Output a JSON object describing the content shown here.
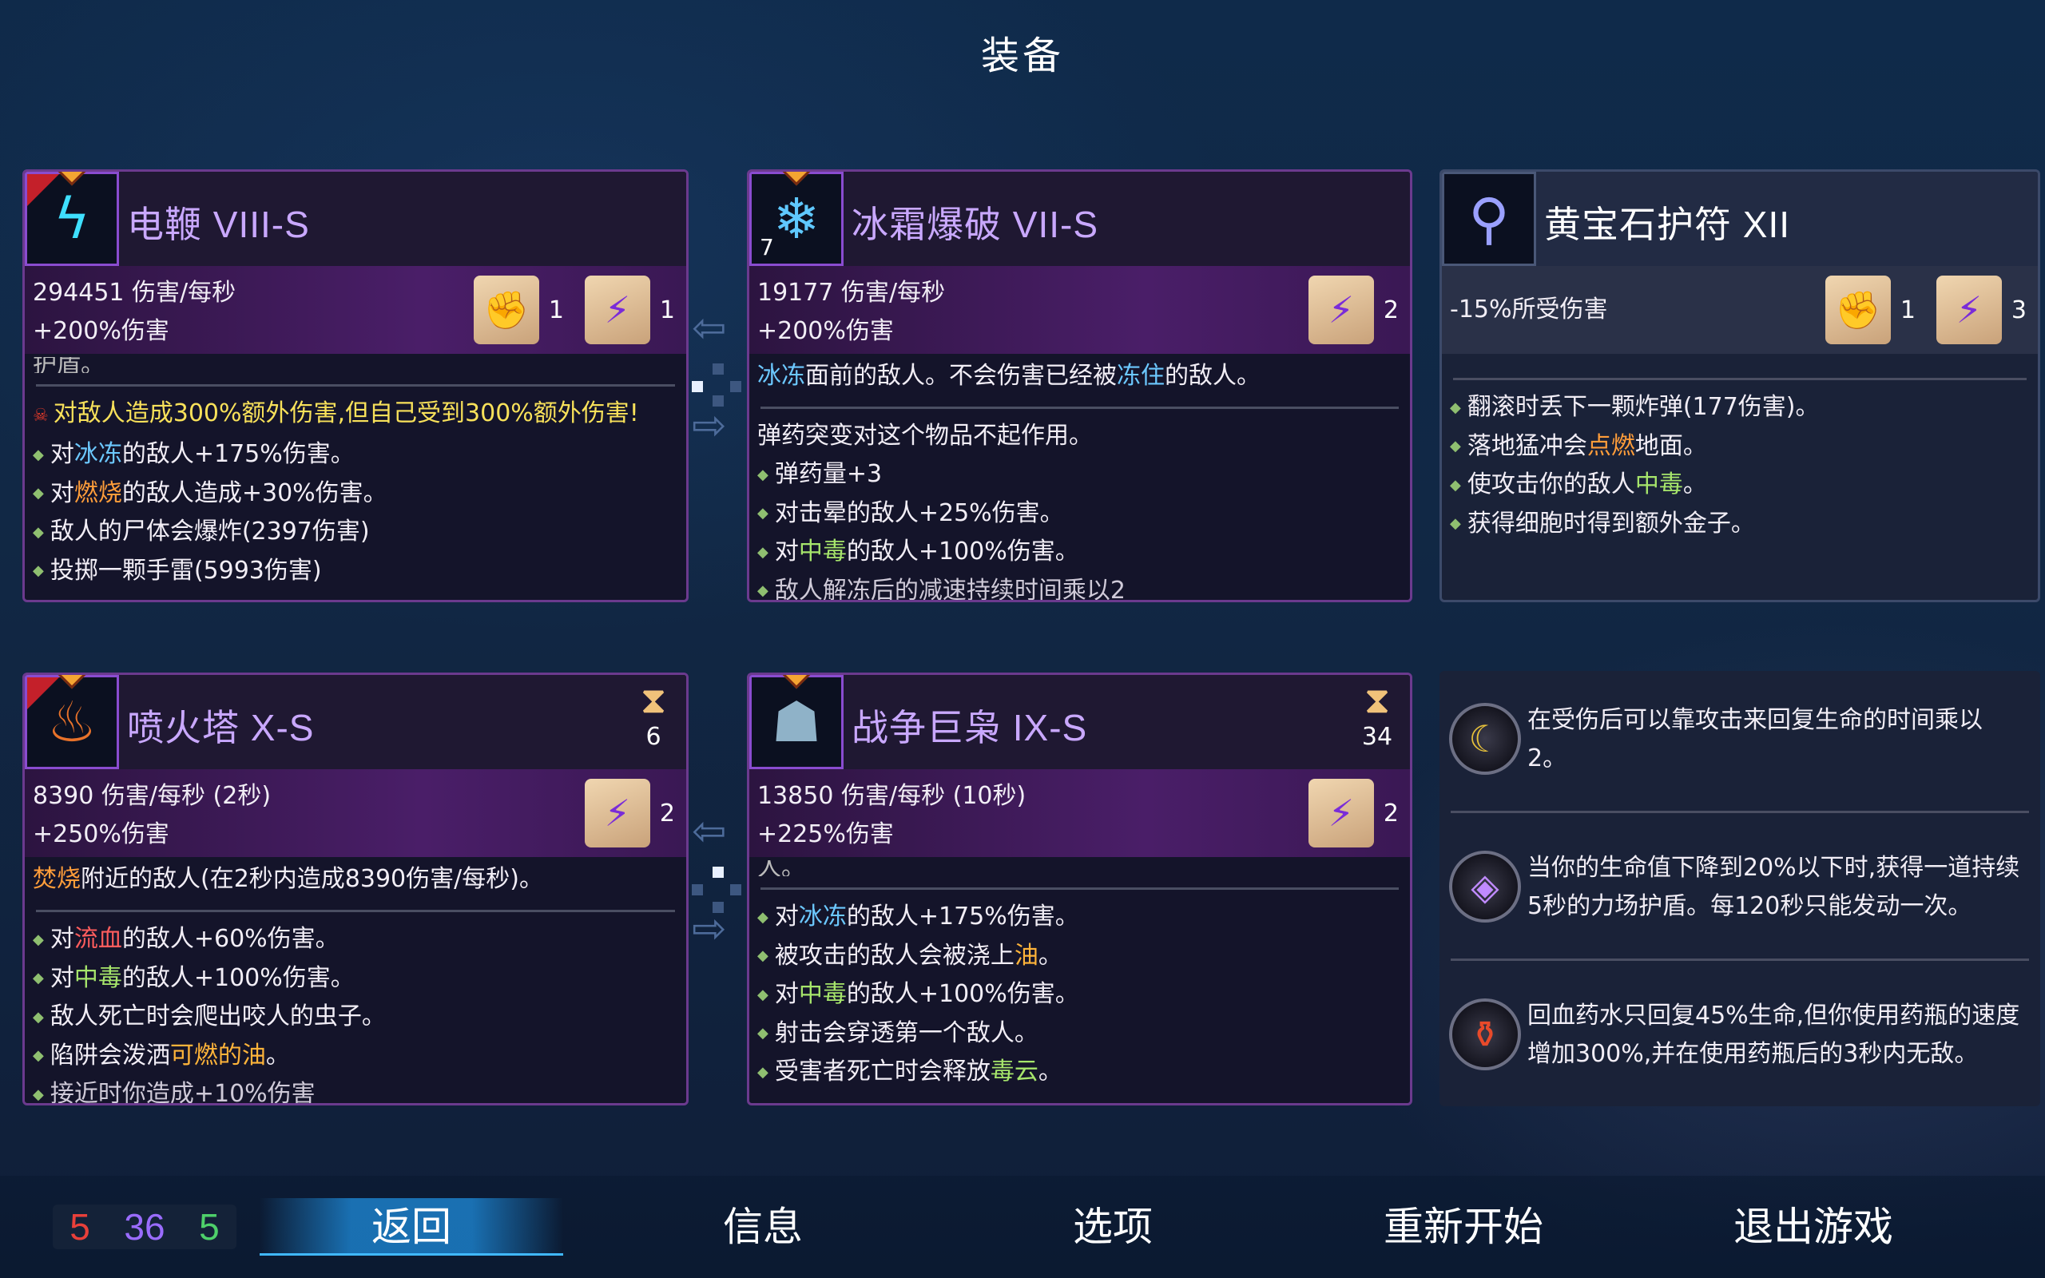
{
  "title": "装备",
  "cards": [
    {
      "name": "电鞭 VIII-S",
      "dps": "294451 伤害/每秒",
      "bonus": "+200%伤害",
      "scrolls": [
        {
          "type": "fist-scroll-icon",
          "count": "1"
        },
        {
          "type": "bolt-scroll-icon",
          "count": "1"
        }
      ],
      "cut_top": "护盾。",
      "curse": "对敌人造成300%额外伤害,但自己受到300%额外伤害!",
      "lines": [
        {
          "pre": "对",
          "hl": "冰冻",
          "post": "的敌人+175%伤害。",
          "cls": "c-ice"
        },
        {
          "pre": "对",
          "hl": "燃烧",
          "post": "的敌人造成+30%伤害。",
          "cls": "c-fire"
        },
        {
          "pre": "敌人的尸体会爆炸(2397伤害)",
          "hl": "",
          "post": "",
          "cls": ""
        },
        {
          "pre": "投掷一颗手雷(5993伤害)",
          "hl": "",
          "post": "",
          "cls": ""
        }
      ]
    },
    {
      "name": "冰霜爆破 VII-S",
      "level": "7",
      "dps": "19177 伤害/每秒",
      "bonus": "+200%伤害",
      "scrolls": [
        {
          "type": "bolt-scroll-icon",
          "count": "2"
        }
      ],
      "desc": {
        "a": "冰冻",
        "b": "面前的敌人。不会伤害已经被",
        "c": "冻住",
        "d": "的敌人。"
      },
      "note": "弹药突变对这个物品不起作用。",
      "lines": [
        {
          "pre": "弹药量+3",
          "hl": "",
          "post": "",
          "cls": ""
        },
        {
          "pre": "对击晕的敌人+25%伤害。",
          "hl": "",
          "post": "",
          "cls": ""
        },
        {
          "pre": "对",
          "hl": "中毒",
          "post": "的敌人+100%伤害。",
          "cls": "c-poison"
        }
      ],
      "cut_bottom": "敌人解冻后的减速持续时间乘以2"
    },
    {
      "name": "黄宝石护符 XII",
      "stat": "-15%所受伤害",
      "scrolls": [
        {
          "type": "fist-scroll-icon",
          "count": "1"
        },
        {
          "type": "bolt-scroll-icon",
          "count": "3"
        }
      ],
      "lines": [
        {
          "pre": "翻滚时丢下一颗炸弹(177伤害)。",
          "hl": "",
          "post": "",
          "cls": ""
        },
        {
          "pre": "落地猛冲会",
          "hl": "点燃",
          "post": "地面。",
          "cls": "c-fire"
        },
        {
          "pre": "使攻击你的敌人",
          "hl": "中毒",
          "post": "。",
          "cls": "c-poison"
        },
        {
          "pre": "获得细胞时得到额外金子。",
          "hl": "",
          "post": "",
          "cls": ""
        }
      ]
    },
    {
      "name": "喷火塔 X-S",
      "timer": "6",
      "dps": "8390 伤害/每秒 (2秒)",
      "bonus": "+250%伤害",
      "scrolls": [
        {
          "type": "bolt-scroll-icon",
          "count": "2"
        }
      ],
      "desc": {
        "a": "焚烧",
        "b": "附近的敌人(在2秒内造成8390伤害/每秒)。"
      },
      "lines": [
        {
          "pre": "对",
          "hl": "流血",
          "post": "的敌人+60%伤害。",
          "cls": "c-blood"
        },
        {
          "pre": "对",
          "hl": "中毒",
          "post": "的敌人+100%伤害。",
          "cls": "c-poison"
        },
        {
          "pre": "敌人死亡时会爬出咬人的虫子。",
          "hl": "",
          "post": "",
          "cls": ""
        },
        {
          "pre": "陷阱会泼洒",
          "hl": "可燃的油",
          "post": "。",
          "cls": "c-oil"
        }
      ],
      "cut_bottom": "接近时你造成+10%伤害"
    },
    {
      "name": "战争巨枭 IX-S",
      "timer": "34",
      "dps": "13850 伤害/每秒 (10秒)",
      "bonus": "+225%伤害",
      "scrolls": [
        {
          "type": "bolt-scroll-icon",
          "count": "2"
        }
      ],
      "cut_top": "人。",
      "lines": [
        {
          "pre": "对",
          "hl": "冰冻",
          "post": "的敌人+175%伤害。",
          "cls": "c-ice"
        },
        {
          "pre": "被攻击的敌人会被浇上",
          "hl": "油",
          "post": "。",
          "cls": "c-oil"
        },
        {
          "pre": "对",
          "hl": "中毒",
          "post": "的敌人+100%伤害。",
          "cls": "c-poison"
        },
        {
          "pre": "射击会穿透第一个敌人。",
          "hl": "",
          "post": "",
          "cls": ""
        },
        {
          "pre": "受害者死亡时会释放",
          "hl": "毒云",
          "post": "。",
          "cls": "c-poison"
        }
      ]
    }
  ],
  "mutations": [
    {
      "icon": "crescent-mutation-icon",
      "text": "在受伤后可以靠攻击来回复生命的时间乘以2。"
    },
    {
      "icon": "shield-mutation-icon",
      "text": "当你的生命值下降到20%以下时,获得一道持续5秒的力场护盾。每120秒只能发动一次。"
    },
    {
      "icon": "potion-mutation-icon",
      "text": "回血药水只回复45%生命,但你使用药瓶的速度增加300%,并在使用药瓶后的3秒内无敌。"
    }
  ],
  "cells": {
    "brutality": "5",
    "tactics": "36",
    "survival": "5"
  },
  "colors": {
    "brutality": "#e8403a",
    "tactics": "#9a6cff",
    "survival": "#4ed06a"
  },
  "menu": {
    "back": "返回",
    "info": "信息",
    "options": "选项",
    "restart": "重新开始",
    "quit": "退出游戏"
  }
}
